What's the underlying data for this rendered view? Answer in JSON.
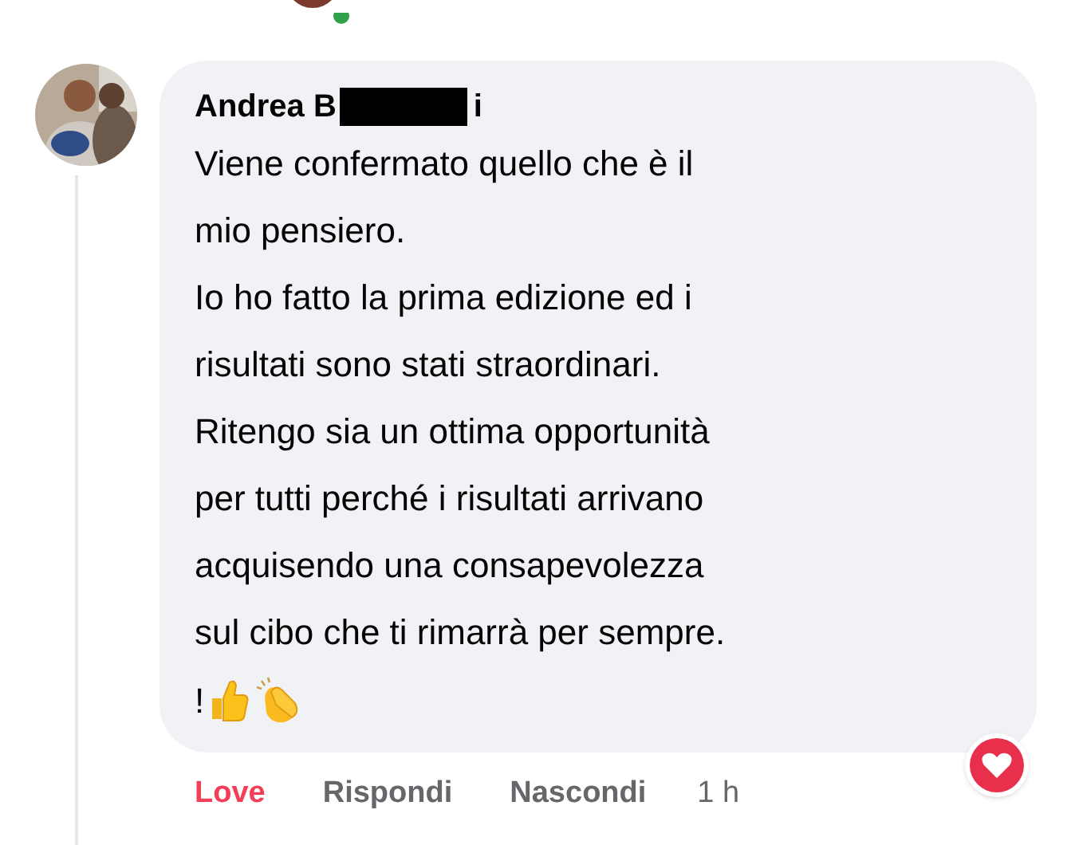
{
  "comment": {
    "author": {
      "visible_start": "Andrea B",
      "visible_end": "i"
    },
    "lines": [
      "Viene confermato quello che è il",
      "mio pensiero.",
      "Io ho fatto la prima edizione ed i",
      "risultati sono stati straordinari.",
      "Ritengo sia un ottima opportunità",
      "per tutti perché i risultati arrivano",
      "acquisendo una consapevolezza",
      "sul cibo che ti rimarrà per sempre."
    ],
    "closing": "!",
    "actions": [
      {
        "label": "Love",
        "selected": true
      },
      {
        "label": "Rispondi",
        "selected": false
      },
      {
        "label": "Nascondi",
        "selected": false
      }
    ],
    "time": "1 h"
  }
}
